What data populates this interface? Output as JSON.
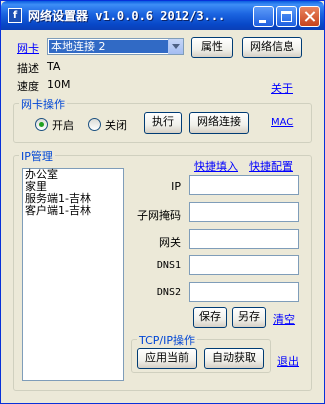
{
  "window": {
    "title": "网络设置器 v1.0.0.6 2012/3...",
    "app_icon_letter": "f"
  },
  "adapter": {
    "label": "网卡",
    "selected": "本地连接 2",
    "properties_button": "属性",
    "network_info_button": "网络信息",
    "desc_label": "描述",
    "desc_value": "TA",
    "speed_label": "速度",
    "speed_value": "10M",
    "about_link": "关于"
  },
  "nic_ops": {
    "title": "网卡操作",
    "on_label": "开启",
    "off_label": "关闭",
    "on_checked": true,
    "execute_button": "执行",
    "network_connect_button": "网络连接",
    "mac_link": "MAC"
  },
  "ip_manage": {
    "title": "IP管理",
    "quick_fill_link": "快捷填入",
    "quick_config_link": "快捷配置",
    "profiles": [
      "办公室",
      "家里",
      "服务端1-吉林",
      "客户端1-吉林"
    ],
    "fields": {
      "ip_label": "IP",
      "ip_value": "",
      "mask_label": "子网掩码",
      "mask_value": "",
      "gateway_label": "网关",
      "gateway_value": "",
      "dns1_label": "DNS1",
      "dns1_value": "",
      "dns2_label": "DNS2",
      "dns2_value": ""
    },
    "save_button": "保存",
    "save_as_button": "另存",
    "clear_link": "清空"
  },
  "tcpip": {
    "title": "TCP/IP操作",
    "apply_button": "应用当前",
    "auto_button": "自动获取",
    "exit_link": "退出"
  },
  "colors": {
    "titlebar": "#0a5de0",
    "link": "#0000ff",
    "group_title": "#0046d5",
    "selection": "#316ac5",
    "face": "#ece9d8"
  }
}
